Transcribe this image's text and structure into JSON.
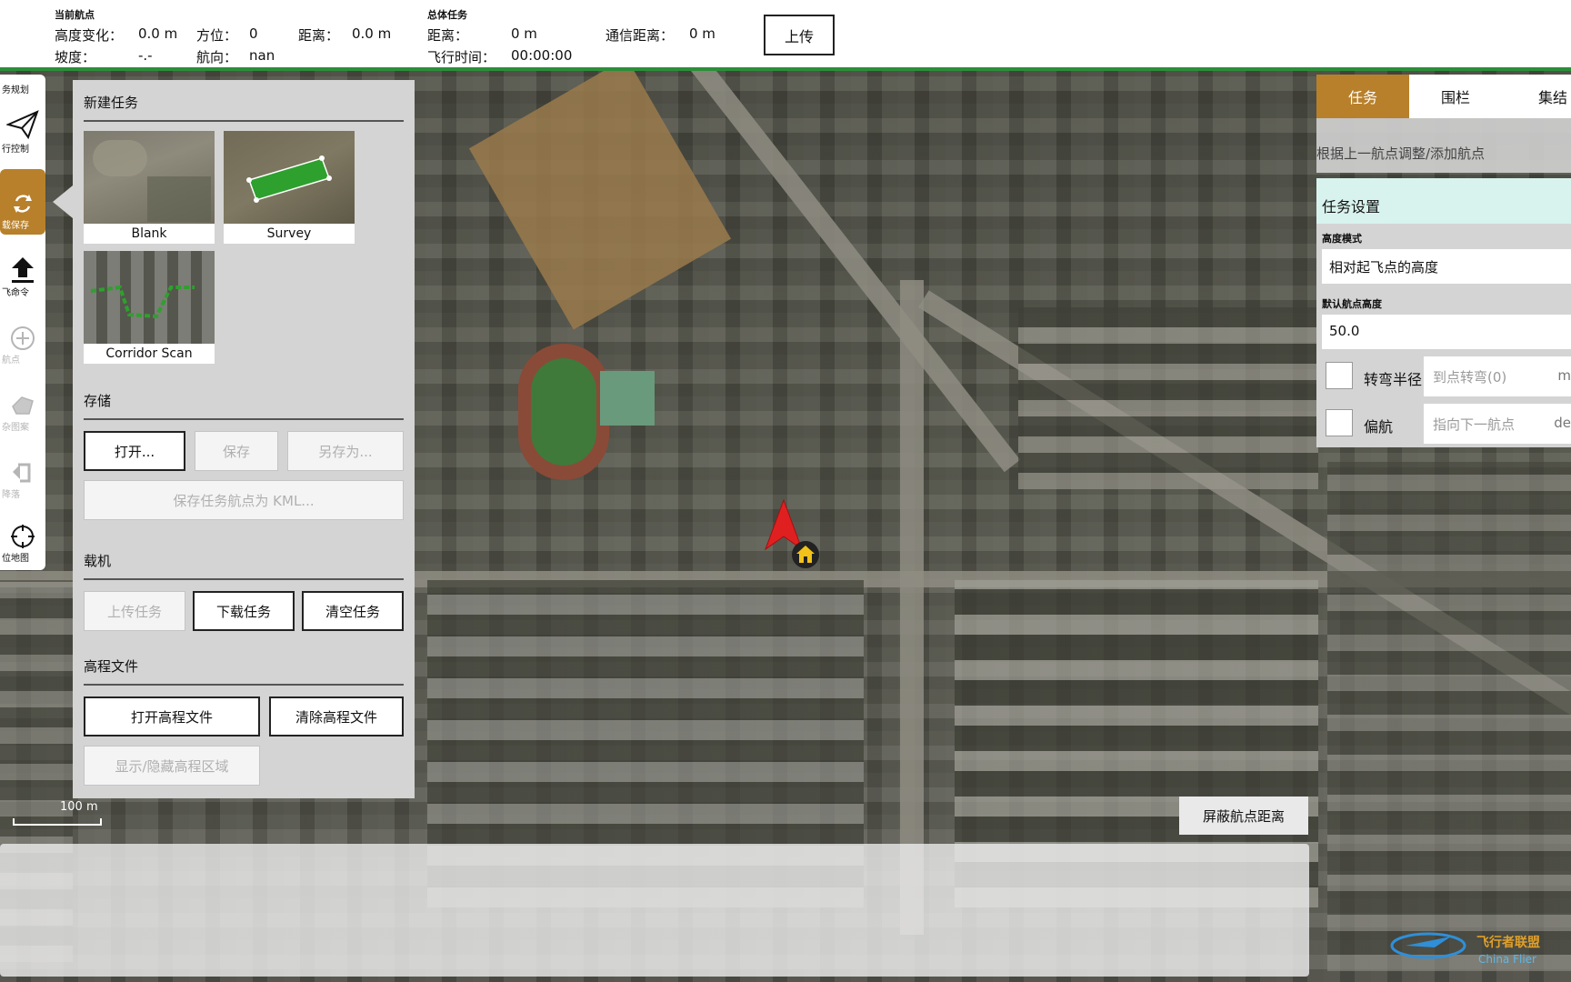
{
  "top": {
    "current_wp_title": "当前航点",
    "alt_change_label": "高度变化：",
    "alt_change_value": "0.0 m",
    "azimuth_label": "方位：",
    "azimuth_value": "0",
    "distance_label": "距离：",
    "distance_value": "0.0 m",
    "gradient_label": "坡度：",
    "gradient_value": "-.-",
    "heading_label": "航向：",
    "heading_value": "nan",
    "total_mission_title": "总体任务",
    "total_dist_label": "距离：",
    "total_dist_value": "0 m",
    "flight_time_label": "飞行时间：",
    "flight_time_value": "00:00:00",
    "comm_dist_label": "通信距离：",
    "comm_dist_value": "0 m",
    "upload_button": "上传"
  },
  "left_toolbar": {
    "top_cut": "务规划",
    "items": [
      {
        "label": "行控制",
        "icon": "paper-plane-icon"
      },
      {
        "label": "载保存",
        "icon": "sync-icon"
      },
      {
        "label": "飞命令",
        "icon": "upload-icon"
      },
      {
        "label": "航点",
        "icon": "plus-circle-icon"
      },
      {
        "label": "杂图案",
        "icon": "shape-icon"
      },
      {
        "label": "降落",
        "icon": "return-icon"
      },
      {
        "label": "位地图",
        "icon": "crosshair-icon"
      }
    ]
  },
  "panel": {
    "new_mission_title": "新建任务",
    "tiles": [
      {
        "label": "Blank"
      },
      {
        "label": "Survey"
      },
      {
        "label": "Corridor Scan"
      }
    ],
    "storage_title": "存储",
    "open_button": "打开...",
    "save_button": "保存",
    "save_as_button": "另存为...",
    "save_kml_button": "保存任务航点为 KML...",
    "vehicle_title": "载机",
    "upload_mission_button": "上传任务",
    "download_mission_button": "下载任务",
    "clear_mission_button": "清空任务",
    "elevation_title": "高程文件",
    "open_elevation_button": "打开高程文件",
    "clear_elevation_button": "清除高程文件",
    "toggle_elevation_button": "显示/隐藏高程区域"
  },
  "right_panel": {
    "tabs": [
      "任务",
      "围栏",
      "集结"
    ],
    "hint": "根据上一航点调整/添加航点",
    "settings_title": "任务设置",
    "alt_mode_label": "高度模式",
    "alt_mode_value": "相对起飞点的高度",
    "default_alt_label": "默认航点高度",
    "default_alt_value": "50.0",
    "turn_radius_label": "转弯半径",
    "turn_radius_placeholder": "到点转弯(0)",
    "turn_radius_unit": "m",
    "yaw_label": "偏航",
    "yaw_placeholder": "指向下一航点",
    "yaw_unit": "de"
  },
  "map": {
    "scale_label": "100 m",
    "hide_distance_button": "屏蔽航点距离",
    "watermark": "飞行者联盟",
    "watermark_sub": "China Flier"
  },
  "colors": {
    "accent": "#b8802a",
    "status_line": "#2b8f3a",
    "panel_bg": "#d4d4d4",
    "settings_header": "#d8f3ee"
  }
}
